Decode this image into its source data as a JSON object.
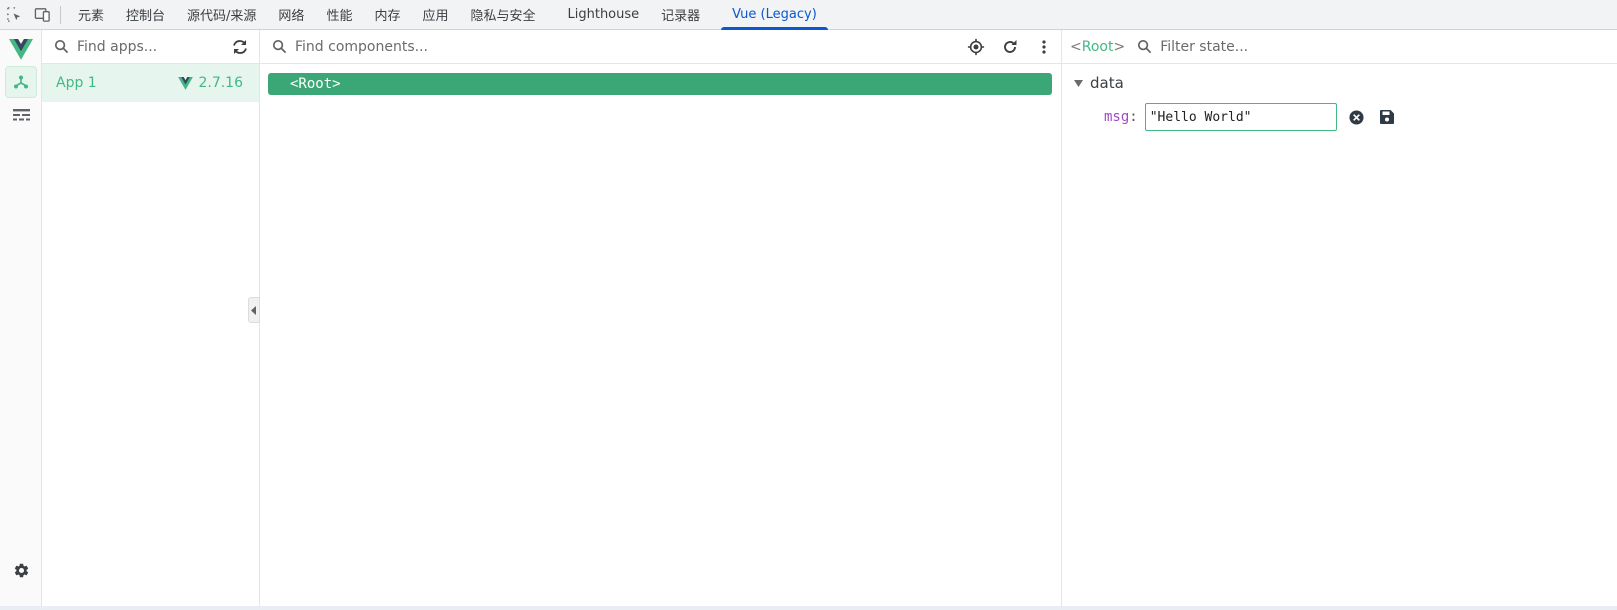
{
  "devtools": {
    "tabs": [
      {
        "label": "元素"
      },
      {
        "label": "控制台"
      },
      {
        "label": "源代码/来源"
      },
      {
        "label": "网络"
      },
      {
        "label": "性能"
      },
      {
        "label": "内存"
      },
      {
        "label": "应用"
      },
      {
        "label": "隐私与安全"
      },
      {
        "label": "Lighthouse"
      },
      {
        "label": "记录器"
      },
      {
        "label": "Vue (Legacy)",
        "active": true
      }
    ],
    "icons": [
      "inspect-element-icon",
      "device-toolbar-icon"
    ]
  },
  "rail": {
    "items": [
      "vue-logo",
      "components-tree-icon",
      "timeline-icon"
    ],
    "bottom": "settings-gear-icon"
  },
  "apps_panel": {
    "search_placeholder": "Find apps...",
    "apps": [
      {
        "name": "App 1",
        "version": "2.7.16",
        "selected": true
      }
    ]
  },
  "components_panel": {
    "search_placeholder": "Find components...",
    "tree": [
      {
        "label": "<Root>",
        "selected": true
      }
    ],
    "actions": [
      "select-component-icon",
      "refresh-icon",
      "more-vert-icon"
    ]
  },
  "state_panel": {
    "crumb_open": "<",
    "crumb_name": "Root",
    "crumb_close": ">",
    "filter_placeholder": "Filter state...",
    "section": "data",
    "props": [
      {
        "key": "msg",
        "value": "\"Hello World\""
      }
    ]
  },
  "colors": {
    "vue_green": "#42b883",
    "selected_row": "#3ba776",
    "active_tab": "#0b57d0",
    "key_purple": "#a447c6"
  }
}
